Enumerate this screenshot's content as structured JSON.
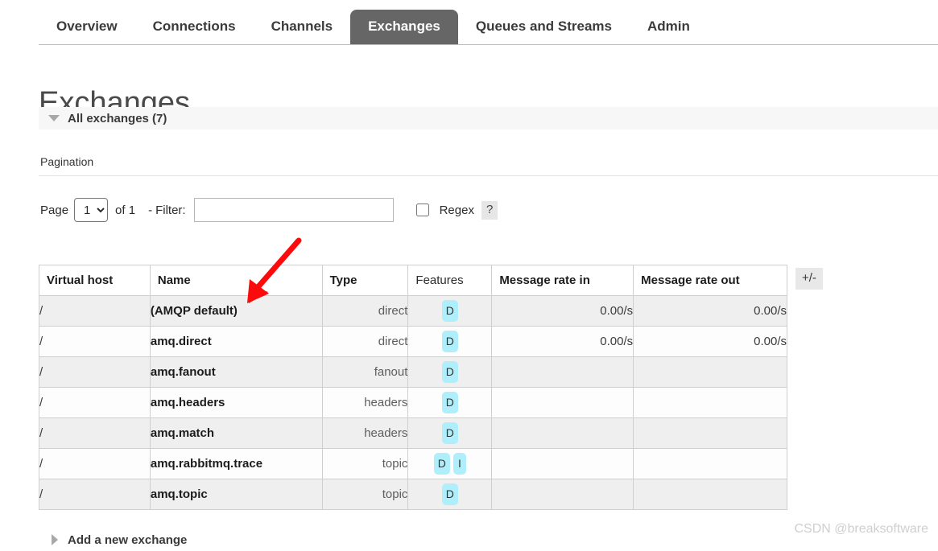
{
  "nav": {
    "tabs": [
      {
        "label": "Overview",
        "active": false
      },
      {
        "label": "Connections",
        "active": false
      },
      {
        "label": "Channels",
        "active": false
      },
      {
        "label": "Exchanges",
        "active": true
      },
      {
        "label": "Queues and Streams",
        "active": false
      },
      {
        "label": "Admin",
        "active": false
      }
    ]
  },
  "page": {
    "title": "Exchanges",
    "section_label": "All exchanges (7)",
    "section_expanded_icon": "triangle-down-icon"
  },
  "pagination": {
    "heading": "Pagination",
    "page_word": "Page",
    "page_value": "1",
    "page_options": [
      "1"
    ],
    "of_text": "of 1",
    "filter_dash": "-",
    "filter_label": "Filter:",
    "filter_value": "",
    "filter_placeholder": "",
    "regex_label": "Regex",
    "regex_checked": false,
    "help_label": "?"
  },
  "table": {
    "columns": [
      {
        "key": "vhost",
        "label": "Virtual host",
        "sortable": true
      },
      {
        "key": "name",
        "label": "Name",
        "sortable": true
      },
      {
        "key": "type",
        "label": "Type",
        "sortable": true
      },
      {
        "key": "features",
        "label": "Features",
        "sortable": false
      },
      {
        "key": "rate_in",
        "label": "Message rate in",
        "sortable": true
      },
      {
        "key": "rate_out",
        "label": "Message rate out",
        "sortable": true
      }
    ],
    "column_toggle_label": "+/-",
    "rows": [
      {
        "vhost": "/",
        "name": "(AMQP default)",
        "type": "direct",
        "features": [
          "D"
        ],
        "rate_in": "0.00/s",
        "rate_out": "0.00/s"
      },
      {
        "vhost": "/",
        "name": "amq.direct",
        "type": "direct",
        "features": [
          "D"
        ],
        "rate_in": "0.00/s",
        "rate_out": "0.00/s"
      },
      {
        "vhost": "/",
        "name": "amq.fanout",
        "type": "fanout",
        "features": [
          "D"
        ],
        "rate_in": "",
        "rate_out": ""
      },
      {
        "vhost": "/",
        "name": "amq.headers",
        "type": "headers",
        "features": [
          "D"
        ],
        "rate_in": "",
        "rate_out": ""
      },
      {
        "vhost": "/",
        "name": "amq.match",
        "type": "headers",
        "features": [
          "D"
        ],
        "rate_in": "",
        "rate_out": ""
      },
      {
        "vhost": "/",
        "name": "amq.rabbitmq.trace",
        "type": "topic",
        "features": [
          "D",
          "I"
        ],
        "rate_in": "",
        "rate_out": ""
      },
      {
        "vhost": "/",
        "name": "amq.topic",
        "type": "topic",
        "features": [
          "D"
        ],
        "rate_in": "",
        "rate_out": ""
      }
    ]
  },
  "add_exchange": {
    "label": "Add a new exchange",
    "collapsed_icon": "triangle-right-icon"
  },
  "annotation": {
    "arrow_color": "#fb0b0b"
  },
  "watermark": {
    "text": "CSDN @breaksoftware"
  },
  "colors": {
    "active_tab_bg": "#666666",
    "feature_badge_bg": "#aeeffb",
    "row_odd_bg": "#efefef",
    "row_even_bg": "#fdfdfd",
    "border": "#cfcfcf"
  }
}
